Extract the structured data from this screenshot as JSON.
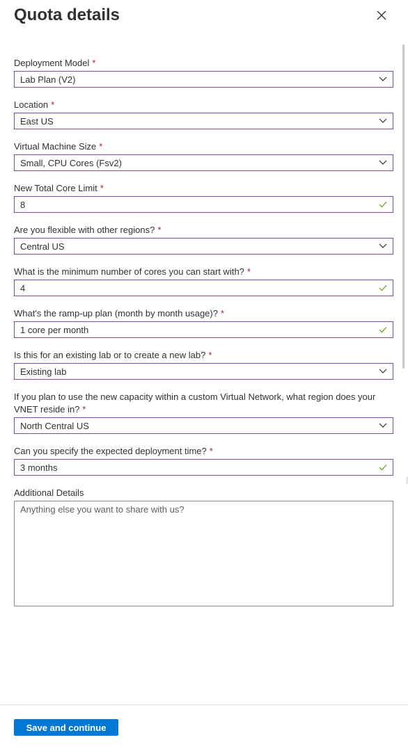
{
  "panel": {
    "title": "Quota details",
    "close_icon": "close-icon"
  },
  "form": {
    "deployment_model": {
      "label": "Deployment Model",
      "required": "*",
      "value": "Lab Plan (V2)",
      "icon": "chevron-down-icon"
    },
    "location": {
      "label": "Location",
      "required": "*",
      "value": "East US",
      "icon": "chevron-down-icon"
    },
    "vm_size": {
      "label": "Virtual Machine Size",
      "required": "*",
      "value": "Small, CPU Cores (Fsv2)",
      "icon": "chevron-down-icon"
    },
    "core_limit": {
      "label": "New Total Core Limit",
      "required": "*",
      "value": "8",
      "icon": "checkmark-icon"
    },
    "flexible_regions": {
      "label": "Are you flexible with other regions?",
      "required": "*",
      "value": "Central US",
      "icon": "chevron-down-icon"
    },
    "min_cores": {
      "label": "What is the minimum number of cores you can start with?",
      "required": "*",
      "value": "4",
      "icon": "checkmark-icon"
    },
    "ramp_up": {
      "label": "What's the ramp-up plan (month by month usage)?",
      "required": "*",
      "value": "1 core per month",
      "icon": "checkmark-icon"
    },
    "lab_type": {
      "label": "Is this for an existing lab or to create a new lab?",
      "required": "*",
      "value": "Existing lab",
      "icon": "chevron-down-icon"
    },
    "vnet_region": {
      "label": "If you plan to use the new capacity within a custom Virtual Network, what region does your VNET reside in?",
      "required": "*",
      "value": "North Central US",
      "icon": "chevron-down-icon"
    },
    "deployment_time": {
      "label": "Can you specify the expected deployment time?",
      "required": "*",
      "value": "3 months",
      "icon": "checkmark-icon"
    },
    "additional_details": {
      "label": "Additional Details",
      "placeholder": "Anything else you want to share with us?",
      "value": ""
    }
  },
  "footer": {
    "save_label": "Save and continue"
  },
  "colors": {
    "accent": "#0078d4",
    "focus_border": "#7a4e9e",
    "required": "#a4262c",
    "valid": "#57a300"
  }
}
